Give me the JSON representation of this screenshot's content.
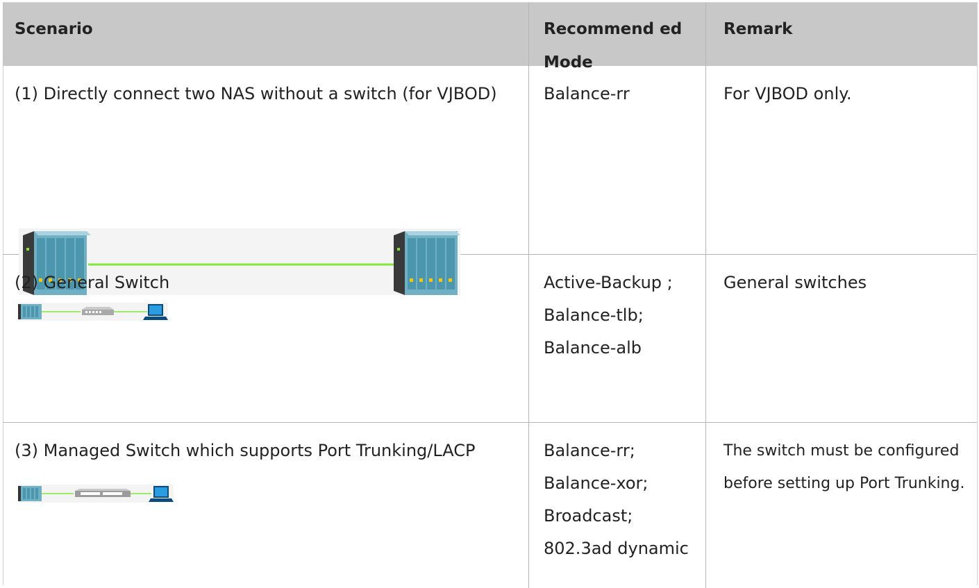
{
  "table": {
    "headers": {
      "scenario": "Scenario",
      "mode": "Recommend ed Mode",
      "remark": "Remark"
    },
    "rows": [
      {
        "scenario": "(1) Directly connect two NAS without a switch (for VJBOD)",
        "mode": "Balance-rr",
        "remark": "For VJBOD only.",
        "diagram_icon": "nas-direct-connection-diagram"
      },
      {
        "scenario": "(2) General Switch",
        "mode": "Active-Backup ; Balance-tlb; Balance-alb",
        "remark": "General switches",
        "diagram_icon": "nas-general-switch-laptop-diagram"
      },
      {
        "scenario": "(3) Managed Switch which supports Port Trunking/LACP",
        "mode": "Balance-rr; Balance-xor; Broadcast; 802.3ad dynamic",
        "remark": "The switch must be configured before setting up Port Trunking.",
        "diagram_icon": "nas-managed-switch-laptop-diagram"
      }
    ]
  },
  "colors": {
    "header_bg": "#c8c8c8",
    "border": "#b5b5b5",
    "cable": "#7ee83c",
    "nas_body": "#7fb6c8",
    "laptop": "#1e8fd8"
  }
}
